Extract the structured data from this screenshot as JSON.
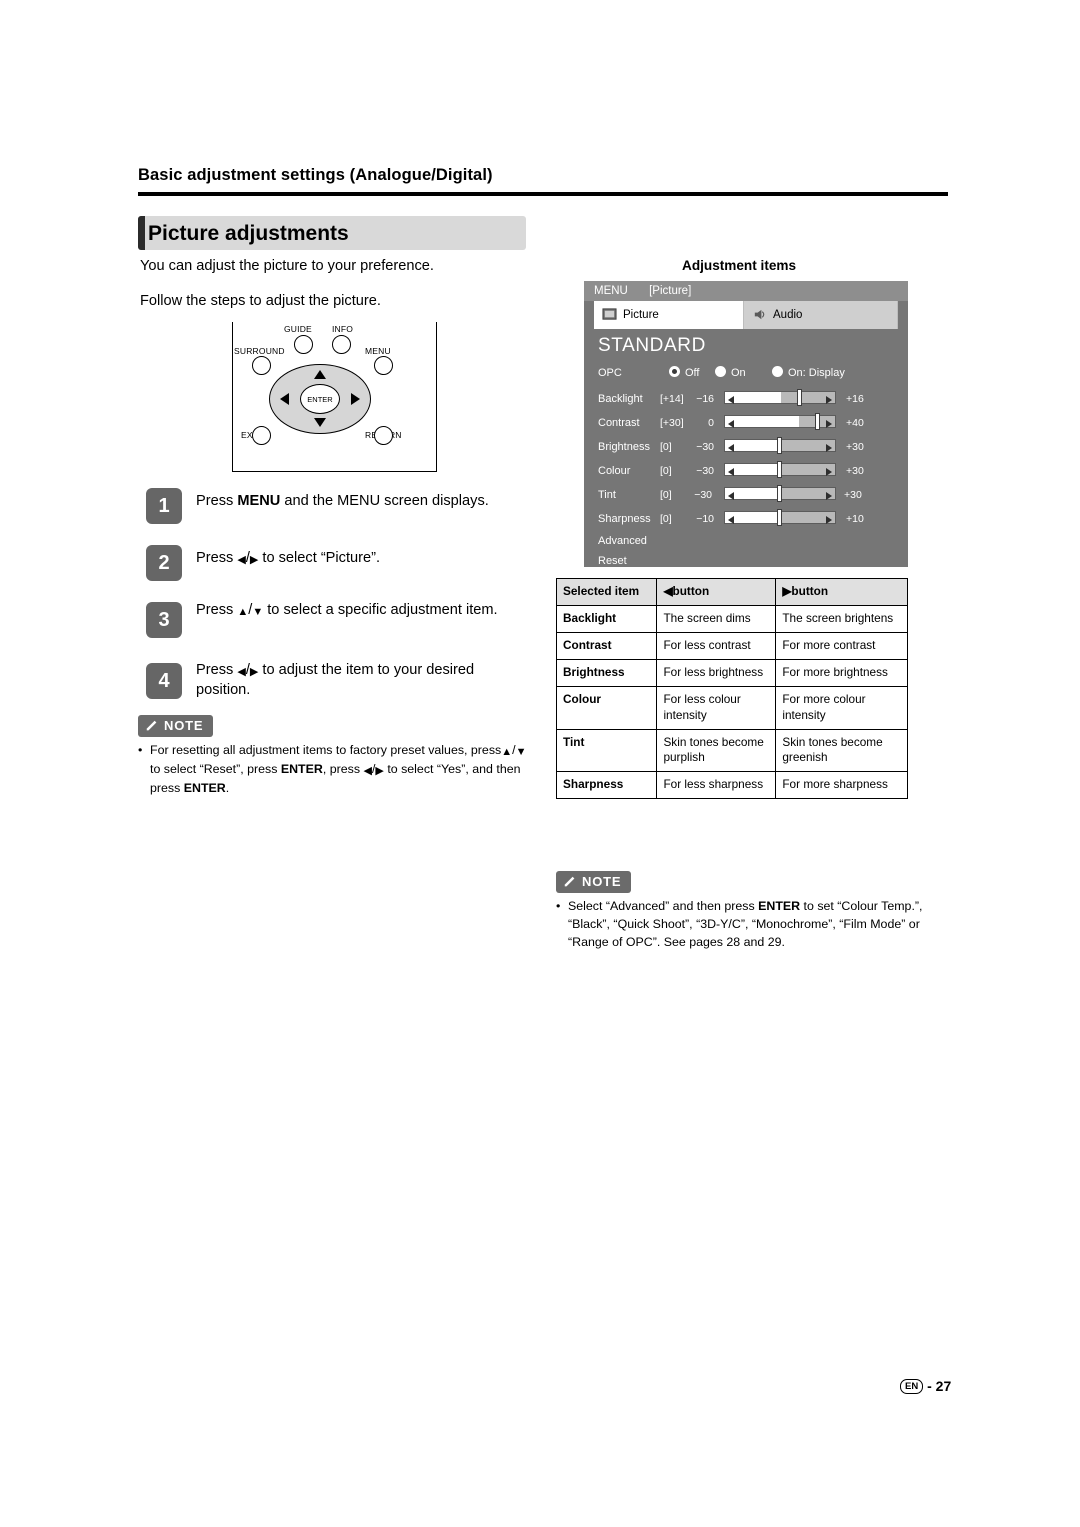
{
  "header": {
    "section": "Basic adjustment settings (Analogue/Digital)",
    "title": "Picture adjustments"
  },
  "intro": {
    "line1": "You can adjust the picture to your preference.",
    "line2": "Follow the steps to adjust the picture."
  },
  "remote": {
    "labels": {
      "guide": "GUIDE",
      "info": "INFO",
      "surround": "SURROUND",
      "menu": "MENU",
      "enter": "ENTER",
      "exit": "EXIT",
      "return": "RETURN"
    }
  },
  "steps": [
    {
      "num": "1",
      "text_html": "Press <b>MENU</b> and the MENU screen displays."
    },
    {
      "num": "2",
      "text_html": "Press <span class=\"ar\">&#9664;</span>/<span class=\"ar\">&#9654;</span> to select “Picture”."
    },
    {
      "num": "3",
      "text_html": "Press <span class=\"ar\">&#9650;</span>/<span class=\"ar\">&#9660;</span> to select a specific adjustment item."
    },
    {
      "num": "4",
      "text_html": "Press <span class=\"ar\">&#9664;</span>/<span class=\"ar\">&#9654;</span> to adjust the item to your desired position."
    }
  ],
  "note_left": {
    "tag": "NOTE",
    "bullet": "•",
    "text_html": "For resetting all adjustment items to factory preset values, press<span class=\"ar\">&#9650;</span>/<span class=\"ar\">&#9660;</span> to select “Reset”, press <b>ENTER</b>, press <span class=\"ar\">&#9664;</span>/<span class=\"ar\">&#9654;</span> to select “Yes”, and then press <b>ENTER</b>."
  },
  "note_right": {
    "tag": "NOTE",
    "bullet": "•",
    "text_html": "Select “Advanced” and then press <b>ENTER</b> to set “Colour Temp.”, “Black”, “Quick Shoot”, “3D-Y/C”, “Monochrome”, “Film Mode” or “Range of OPC”. See pages 28 and 29."
  },
  "osd": {
    "caption": "Adjustment items",
    "menubar_left": "MENU",
    "menubar_right": "[Picture]",
    "tabs": [
      {
        "label": "Picture",
        "icon": "picture-icon",
        "selected": true
      },
      {
        "label": "Audio",
        "icon": "audio-icon",
        "selected": false
      }
    ],
    "preset": "STANDARD",
    "opc": {
      "label": "OPC",
      "options": [
        "Off",
        "On",
        "On: Display"
      ],
      "selected": "Off"
    },
    "rows": [
      {
        "label": "Backlight",
        "value": "[+14]",
        "min": "−16",
        "max": "+16",
        "fill": 0.5,
        "knob": 0.66
      },
      {
        "label": "Contrast",
        "value": "[+30]",
        "min": "0",
        "max": "+40",
        "fill": 0.66,
        "knob": 0.8
      },
      {
        "label": "Brightness",
        "value": "[0]",
        "min": "−30",
        "max": "+30",
        "fill": 0.5,
        "knob": 0.5
      },
      {
        "label": "Colour",
        "value": "[0]",
        "min": "−30",
        "max": "+30",
        "fill": 0.5,
        "knob": 0.5
      },
      {
        "label": "Tint",
        "value": "[0]",
        "min": "−30",
        "max": "+30",
        "fill": 0.5,
        "knob": 0.5
      },
      {
        "label": "Sharpness",
        "value": "[0]",
        "min": "−10",
        "max": "+10",
        "fill": 0.5,
        "knob": 0.5
      }
    ],
    "advanced": "Advanced",
    "reset": "Reset"
  },
  "table": {
    "headers": [
      "Selected item",
      "◀button",
      "▶button"
    ],
    "rows": [
      [
        "Backlight",
        "The screen dims",
        "The screen brightens"
      ],
      [
        "Contrast",
        "For less contrast",
        "For more contrast"
      ],
      [
        "Brightness",
        "For less brightness",
        "For more brightness"
      ],
      [
        "Colour",
        "For less colour intensity",
        "For more colour intensity"
      ],
      [
        "Tint",
        "Skin tones become purplish",
        "Skin tones become greenish"
      ],
      [
        "Sharpness",
        "For less sharpness",
        "For more sharpness"
      ]
    ]
  },
  "footer": {
    "lang": "EN",
    "dash": "-",
    "page": "27"
  }
}
